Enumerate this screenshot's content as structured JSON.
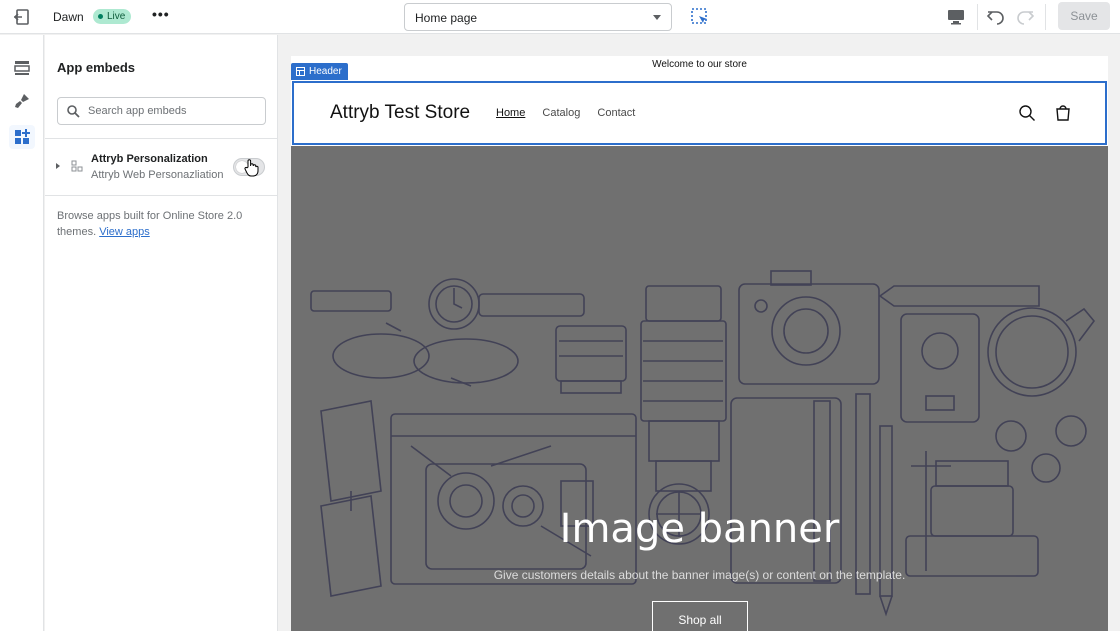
{
  "topbar": {
    "theme_name": "Dawn",
    "live_badge": "Live",
    "more_label": "•••",
    "page_select": "Home page",
    "save_label": "Save"
  },
  "sidebar": {
    "title": "App embeds",
    "search_placeholder": "Search app embeds",
    "embed": {
      "name": "Attryb Personalization",
      "subtitle": "Attryb Web Personazliation",
      "enabled": false
    },
    "browse_text": "Browse apps built for Online Store 2.0 themes.",
    "browse_link": "View apps"
  },
  "preview": {
    "announcement": "Welcome to our store",
    "header_tag": "Header",
    "store_name": "Attryb Test Store",
    "nav": [
      "Home",
      "Catalog",
      "Contact"
    ],
    "banner_title": "Image banner",
    "banner_subtitle": "Give customers details about the banner image(s) or content on the template.",
    "banner_button": "Shop all"
  },
  "colors": {
    "accent": "#2c6ecb",
    "live_bg": "#aee9d1",
    "banner_bg": "#707070"
  }
}
